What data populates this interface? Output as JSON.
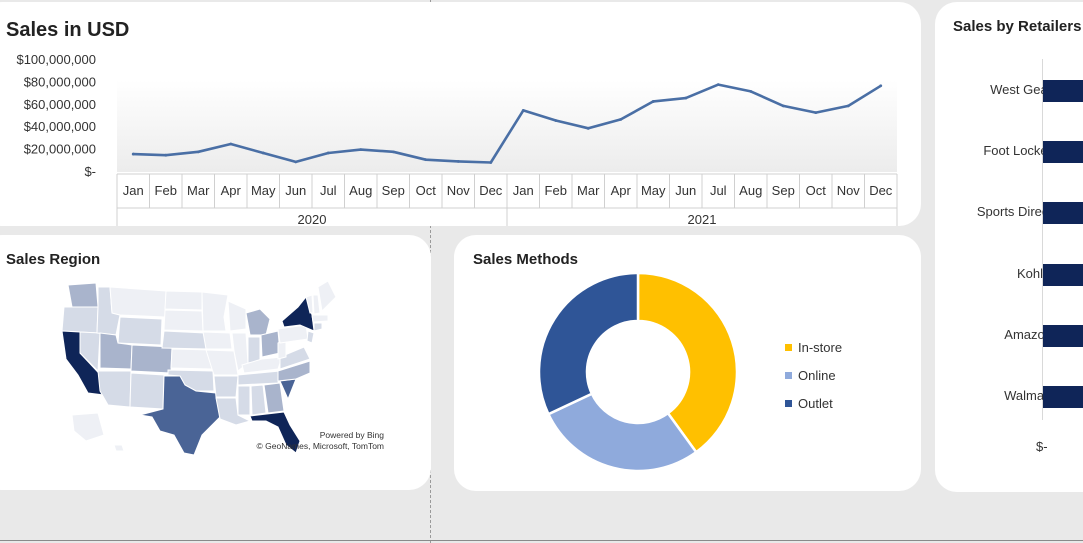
{
  "sales_card": {
    "title": "Sales in USD",
    "chart_data": {
      "type": "line",
      "title": "Sales in USD",
      "categories": [
        "Jan",
        "Feb",
        "Mar",
        "Apr",
        "May",
        "Jun",
        "Jul",
        "Aug",
        "Sep",
        "Oct",
        "Nov",
        "Dec",
        "Jan",
        "Feb",
        "Mar",
        "Apr",
        "May",
        "Jun",
        "Jul",
        "Aug",
        "Sep",
        "Oct",
        "Nov",
        "Dec"
      ],
      "groups": [
        {
          "label": "2020",
          "start": 0,
          "end": 11
        },
        {
          "label": "2021",
          "start": 12,
          "end": 23
        }
      ],
      "series": [
        {
          "color": "#4a6fa5",
          "values": [
            16000000,
            15000000,
            18000000,
            25000000,
            17000000,
            9000000,
            17000000,
            20000000,
            18000000,
            11000000,
            9500000,
            8500000,
            55000000,
            46000000,
            39000000,
            47000000,
            63000000,
            66000000,
            78000000,
            72000000,
            59000000,
            53000000,
            59000000,
            77000000
          ]
        }
      ],
      "y_ticks": [
        "$-",
        "$20,000,000",
        "$40,000,000",
        "$60,000,000",
        "$80,000,000",
        "$100,000,000"
      ],
      "ylim": [
        0,
        100000000
      ],
      "grid": false
    }
  },
  "retailers_card": {
    "title": "Sales by Retailers",
    "chart_data": {
      "type": "bar",
      "orientation": "horizontal",
      "categories": [
        "West Gear",
        "Foot Locker",
        "Sports Direct",
        "Kohl's",
        "Amazon",
        "Walmart"
      ],
      "x_tick": "$-",
      "color": "#0f2558"
    }
  },
  "region_card": {
    "title": "Sales Region",
    "attribution_line1": "Powered by Bing",
    "attribution_line2": "© GeoNames, Microsoft, TomTom",
    "colors": {
      "highest": "#0f2558",
      "high": "#4a6496",
      "mid": "#a9b4cc",
      "low": "#d5dbe7",
      "lowest": "#eef0f5"
    }
  },
  "methods_card": {
    "title": "Sales Methods",
    "chart_data": {
      "type": "pie",
      "variant": "donut",
      "categories": [
        "In-store",
        "Online",
        "Outlet"
      ],
      "values": [
        40,
        28,
        32
      ],
      "colors": [
        "#ffc000",
        "#8faadc",
        "#2f5597"
      ],
      "legend": "right"
    }
  }
}
